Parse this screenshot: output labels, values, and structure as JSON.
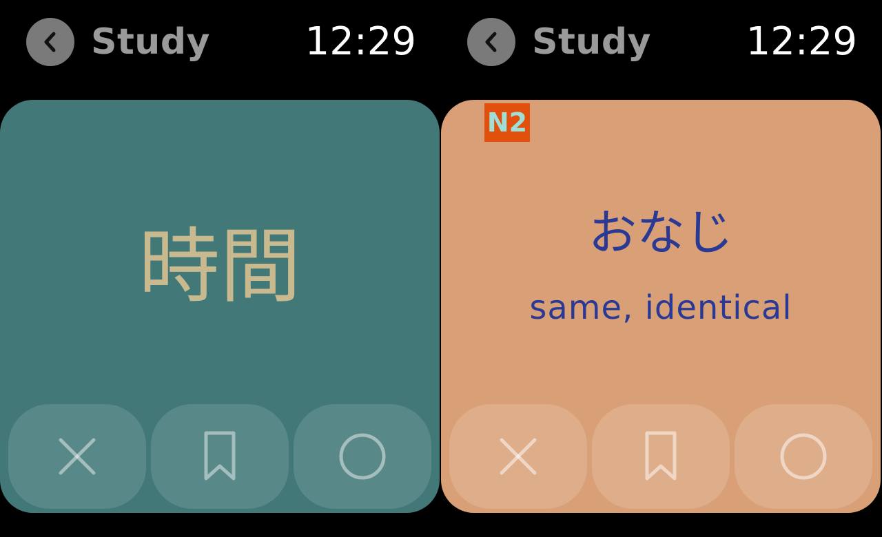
{
  "screens": [
    {
      "status": {
        "back_label": "Study",
        "time": "12:29"
      },
      "card": {
        "kanji": "時間",
        "background": "#437878",
        "text_color": "#c9b98e"
      },
      "actions": [
        {
          "icon": "close-icon"
        },
        {
          "icon": "bookmark-icon"
        },
        {
          "icon": "circle-icon"
        }
      ]
    },
    {
      "status": {
        "back_label": "Study",
        "time": "12:29"
      },
      "card": {
        "level": "N2",
        "reading": "おなじ",
        "meaning": "same, identical",
        "background": "#d99f76",
        "text_color": "#2a3a94",
        "badge_color": "#e2500d"
      },
      "actions": [
        {
          "icon": "close-icon"
        },
        {
          "icon": "bookmark-icon"
        },
        {
          "icon": "circle-icon"
        }
      ]
    }
  ],
  "colors": {
    "background": "#000000",
    "back_circle": "#7a7a7a",
    "back_label": "#9a9a9a",
    "clock": "#ffffff"
  }
}
